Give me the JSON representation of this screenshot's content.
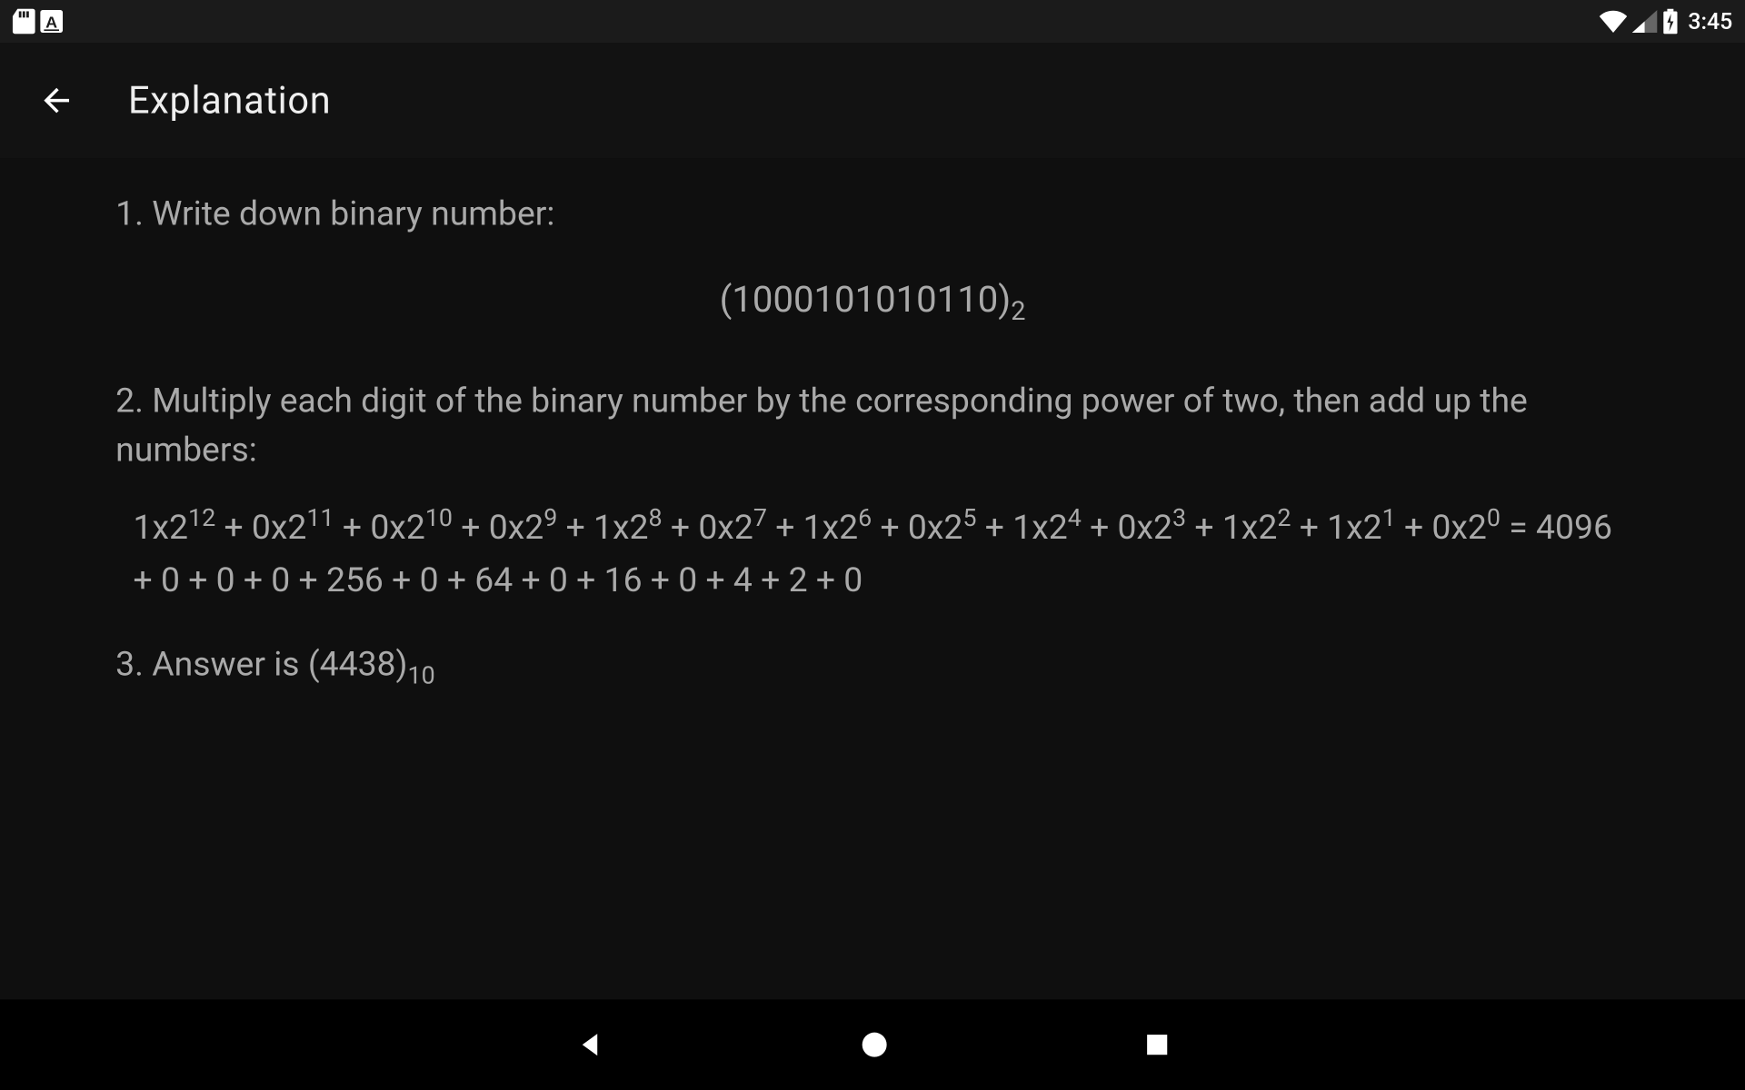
{
  "status": {
    "time": "3:45"
  },
  "appbar": {
    "title": "Explanation"
  },
  "steps": {
    "s1_label": "1. Write down binary number:",
    "binary_value": "1000101010110",
    "binary_base": "2",
    "s2_label": "2. Multiply each digit of the binary number by the corresponding power of two, then add up the numbers:",
    "s3_prefix": "3. Answer is ",
    "answer_value": "4438",
    "answer_base": "10"
  },
  "expansion": {
    "terms": [
      {
        "d": "1",
        "p": "12"
      },
      {
        "d": "0",
        "p": "11"
      },
      {
        "d": "0",
        "p": "10"
      },
      {
        "d": "0",
        "p": "9"
      },
      {
        "d": "1",
        "p": "8"
      },
      {
        "d": "0",
        "p": "7"
      },
      {
        "d": "1",
        "p": "6"
      },
      {
        "d": "0",
        "p": "5"
      },
      {
        "d": "1",
        "p": "4"
      },
      {
        "d": "0",
        "p": "3"
      },
      {
        "d": "1",
        "p": "2"
      },
      {
        "d": "1",
        "p": "1"
      },
      {
        "d": "0",
        "p": "0"
      }
    ],
    "sum_values": [
      "4096",
      "0",
      "0",
      "0",
      "256",
      "0",
      "64",
      "0",
      "16",
      "0",
      "4",
      "2",
      "0"
    ]
  }
}
